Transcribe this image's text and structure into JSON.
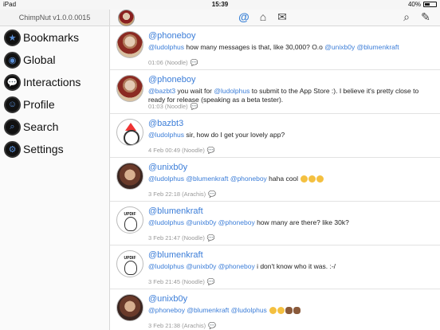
{
  "status": {
    "device": "iPad",
    "time": "15:39",
    "battery": "40%"
  },
  "app": {
    "title": "ChimpNut v1.0.0.0015"
  },
  "sidebar": {
    "items": [
      {
        "label": "Bookmarks",
        "icon": "star-icon",
        "glyph": "★"
      },
      {
        "label": "Global",
        "icon": "globe-icon",
        "glyph": "◉"
      },
      {
        "label": "Interactions",
        "icon": "speech-bubble-icon",
        "glyph": "💬"
      },
      {
        "label": "Profile",
        "icon": "profile-icon",
        "glyph": "☺"
      },
      {
        "label": "Search",
        "icon": "search-icon",
        "glyph": "⌕"
      },
      {
        "label": "Settings",
        "icon": "gear-icon",
        "glyph": "⚙"
      }
    ]
  },
  "toolbar": {
    "mentions_glyph": "@",
    "home_glyph": "⌂",
    "mail_glyph": "✉",
    "search_glyph": "⌕",
    "compose_glyph": "✎"
  },
  "posts": [
    {
      "handle": "@phoneboy",
      "avatar": "av-photo",
      "segments": [
        [
          "@ludolphus",
          "m"
        ],
        [
          " how many messages is that, like 30,000? O.o ",
          ""
        ],
        [
          "@unixb0y",
          "m"
        ],
        [
          " ",
          ""
        ],
        [
          "@blumenkraft",
          "m"
        ]
      ],
      "meta": "01:06 (Noodle)"
    },
    {
      "handle": "@phoneboy",
      "avatar": "av-photo",
      "segments": [
        [
          "@bazbt3",
          "m"
        ],
        [
          " you wait for ",
          ""
        ],
        [
          "@ludolphus",
          "m"
        ],
        [
          " to submit to the App Store :). I believe it's pretty close to ready for release (speaking as a beta tester).",
          ""
        ]
      ],
      "meta": "01:03 (Noodle)"
    },
    {
      "handle": "@bazbt3",
      "avatar": "av-bazbt3",
      "segments": [
        [
          "@ludolphus",
          "m"
        ],
        [
          " sir, how do I get your lovely app?",
          ""
        ]
      ],
      "meta": "4 Feb 00:49 (Noodle)"
    },
    {
      "handle": "@unixb0y",
      "avatar": "av-unix",
      "segments": [
        [
          "@ludolphus",
          "m"
        ],
        [
          " ",
          ""
        ],
        [
          "@blumenkraft",
          "m"
        ],
        [
          " ",
          ""
        ],
        [
          "@phoneboy",
          "m"
        ],
        [
          " haha cool ",
          ""
        ]
      ],
      "emojis": [
        "e",
        "e",
        "e"
      ],
      "meta": "3 Feb 22:18 (Arachis)"
    },
    {
      "handle": "@blumenkraft",
      "avatar": "av-blumen",
      "segments": [
        [
          "@ludolphus",
          "m"
        ],
        [
          " ",
          ""
        ],
        [
          "@unixb0y",
          "m"
        ],
        [
          " ",
          ""
        ],
        [
          "@phoneboy",
          "m"
        ],
        [
          " how many are there? like 30k?",
          ""
        ]
      ],
      "meta": "3 Feb 21:47 (Noodle)"
    },
    {
      "handle": "@blumenkraft",
      "avatar": "av-blumen",
      "segments": [
        [
          "@ludolphus",
          "m"
        ],
        [
          " ",
          ""
        ],
        [
          "@unixb0y",
          "m"
        ],
        [
          " ",
          ""
        ],
        [
          "@phoneboy",
          "m"
        ],
        [
          " i don't know who it was.  :-/",
          ""
        ]
      ],
      "meta": "3 Feb 21:45 (Noodle)"
    },
    {
      "handle": "@unixb0y",
      "avatar": "av-unix",
      "segments": [
        [
          "@phoneboy",
          "m"
        ],
        [
          " ",
          ""
        ],
        [
          "@blumenkraft",
          "m"
        ],
        [
          " ",
          ""
        ],
        [
          "@ludolphus",
          "m"
        ],
        [
          " ",
          ""
        ]
      ],
      "emojis": [
        "e",
        "e",
        "monkey",
        "monkey"
      ],
      "meta": "3 Feb 21:38 (Arachis)"
    }
  ]
}
